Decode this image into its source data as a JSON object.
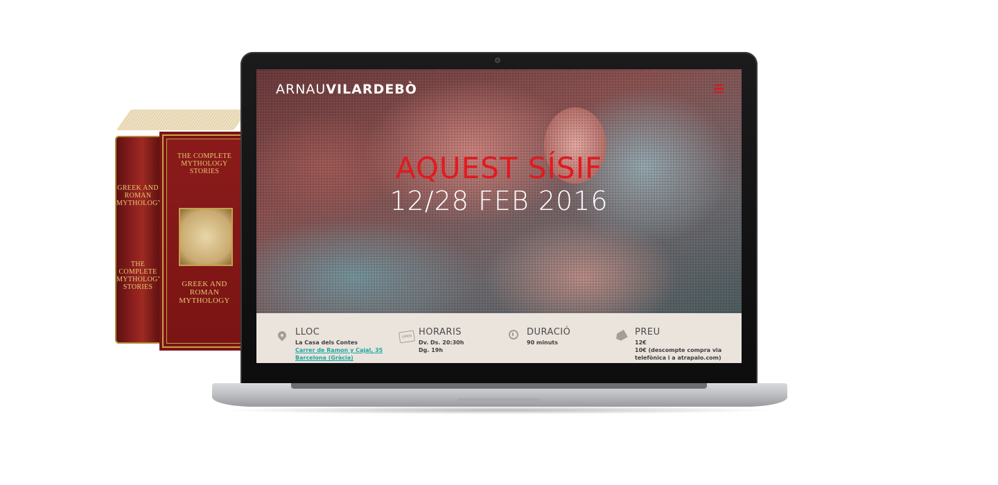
{
  "header": {
    "logo_first": "ARNAU",
    "logo_last": "VILARDEBÒ"
  },
  "hero": {
    "title": "AQUEST SÍSIF",
    "dates": "12/28 FEB 2016"
  },
  "info": {
    "lloc": {
      "title": "LLOC",
      "venue": "La Casa dels Contes",
      "address_link": "Carrer de Ramon y Cajal, 35",
      "city_link": "Barcelona (Gràcia)"
    },
    "horaris": {
      "title": "HORARIS",
      "line1": "Dv. Ds. 20:30h",
      "line2": "Dg. 19h",
      "icon_text": "OPEN"
    },
    "duracio": {
      "title": "DURACIÓ",
      "line1": "90 minuts"
    },
    "preu": {
      "title": "PREU",
      "line1": "12€",
      "line2": "10€ (descompte compra via",
      "line3": "telefònica i a atrapalo.com)"
    }
  },
  "book": {
    "cover_top": "THE COMPLETE MYTHOLOGY STORIES",
    "cover_bottom": "GREEK AND ROMAN MYTHOLOGY",
    "spine_top": "GREEK AND ROMAN MYTHOLOGY",
    "spine_bottom": "THE COMPLETE MYTHOLOGY STORIES"
  },
  "colors": {
    "accent": "#e11a1f",
    "link": "#1aa7a0",
    "info_bg": "#ebe4dd",
    "icon": "#a49d97"
  },
  "icons": {
    "menu": "hamburger-menu-icon",
    "lloc": "map-pin-icon",
    "horaris": "open-sign-icon",
    "duracio": "stopwatch-icon",
    "preu": "price-tag-icon"
  }
}
